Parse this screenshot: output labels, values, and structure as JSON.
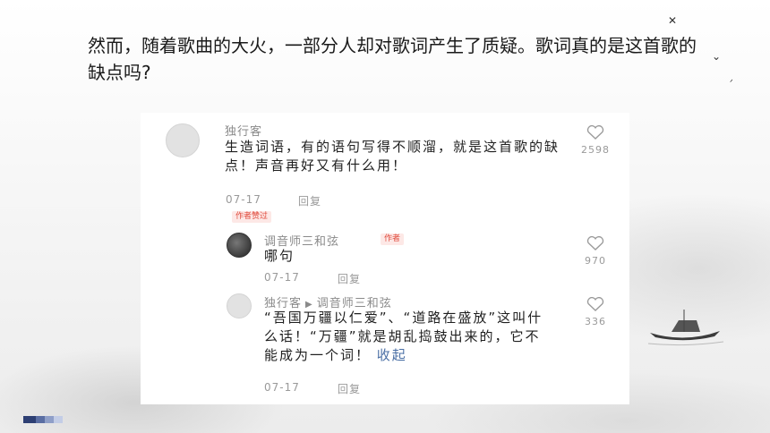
{
  "slide": {
    "question": "然而，随着歌曲的大火，一部分人却对歌词产生了质疑。歌词真的是这首歌的缺点吗?"
  },
  "comments": [
    {
      "user": "独行客",
      "text": "生造词语，有的语句写得不顺溜，就是这首歌的缺点！声音再好又有什么用！",
      "date": "07-17",
      "reply": "回复",
      "badge": "作者赞过",
      "likes": "2598"
    },
    {
      "user": "调音师三和弦",
      "badge": "作者",
      "text": "哪句",
      "date": "07-17",
      "reply": "回复",
      "likes": "970"
    },
    {
      "user": "独行客",
      "reply_to": "调音师三和弦",
      "text": "“吾国万疆以仁爱”、“道路在盛放”这叫什么话！“万疆”就是胡乱捣鼓出来的，它不能成为一个词！",
      "collapse": "收起",
      "date": "07-17",
      "reply": "回复",
      "likes": "336"
    }
  ]
}
